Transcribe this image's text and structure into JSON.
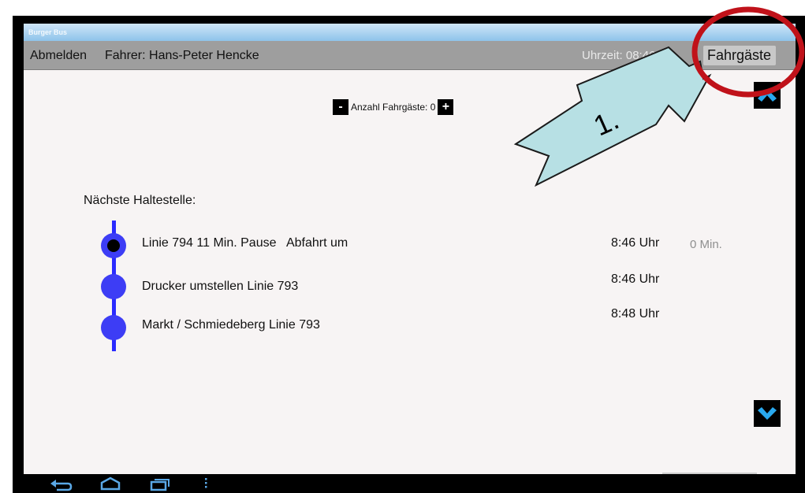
{
  "window": {
    "title": "Burger Bus"
  },
  "header": {
    "logout_label": "Abmelden",
    "driver_text": "Fahrer: Hans-Peter Hencke",
    "time_text": "Uhrzeit: 08:46:00",
    "passengers_tab_label": "Fahrgäste"
  },
  "passenger_counter": {
    "minus_label": "-",
    "label": "Anzahl Fahrgäste: 0",
    "plus_label": "+"
  },
  "next_stop_label": "Nächste Haltestelle:",
  "stops": [
    {
      "name": "Linie 794 11 Min. Pause   Abfahrt um",
      "time": "8:46 Uhr",
      "delay": "0 Min.",
      "current": true
    },
    {
      "name": "Drucker umstellen Linie 793",
      "time": "8:46 Uhr",
      "delay": "",
      "current": false
    },
    {
      "name": "Markt / Schmiedeberg Linie 793",
      "time": "8:48 Uhr",
      "delay": "",
      "current": false
    }
  ],
  "icons": {
    "scroll_up": "chevron-up-icon",
    "scroll_down": "chevron-down-icon",
    "nav_back": "back-icon",
    "nav_home": "home-icon",
    "nav_recent": "recent-apps-icon",
    "nav_menu": "menu-icon"
  },
  "annotation": {
    "step_label": "1."
  },
  "colors": {
    "accent_blue": "#3d3df5",
    "scroll_arrow": "#29a9ef",
    "callout_fill": "#b7e0e4",
    "highlight_circle": "#c0121a"
  }
}
